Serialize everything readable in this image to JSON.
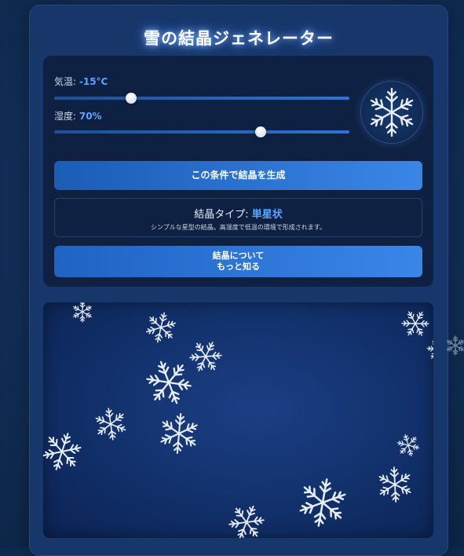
{
  "title": "雪の結晶ジェネレーター",
  "temperature": {
    "label": "気温: ",
    "value": "-15°C",
    "slider_fraction": 0.26
  },
  "humidity": {
    "label": "湿度: ",
    "value": "70%",
    "slider_fraction": 0.7
  },
  "generate_button": "この条件で結晶を生成",
  "crystal_type": {
    "label": "結晶タイプ: ",
    "value": "単星状",
    "description": "シンプルな星型の結晶。高湿度で低温の環境で形成されます。"
  },
  "learn_more_button": {
    "line1": "結晶について",
    "line2": "もっと知る"
  },
  "colors": {
    "accent": "#5aa6ff",
    "button_start": "#1b5cb6",
    "button_end": "#3a86e8",
    "flake": "#e8eef8"
  },
  "icons": {
    "preview": "snowflake-icon",
    "falling": "snowflake-icon"
  }
}
